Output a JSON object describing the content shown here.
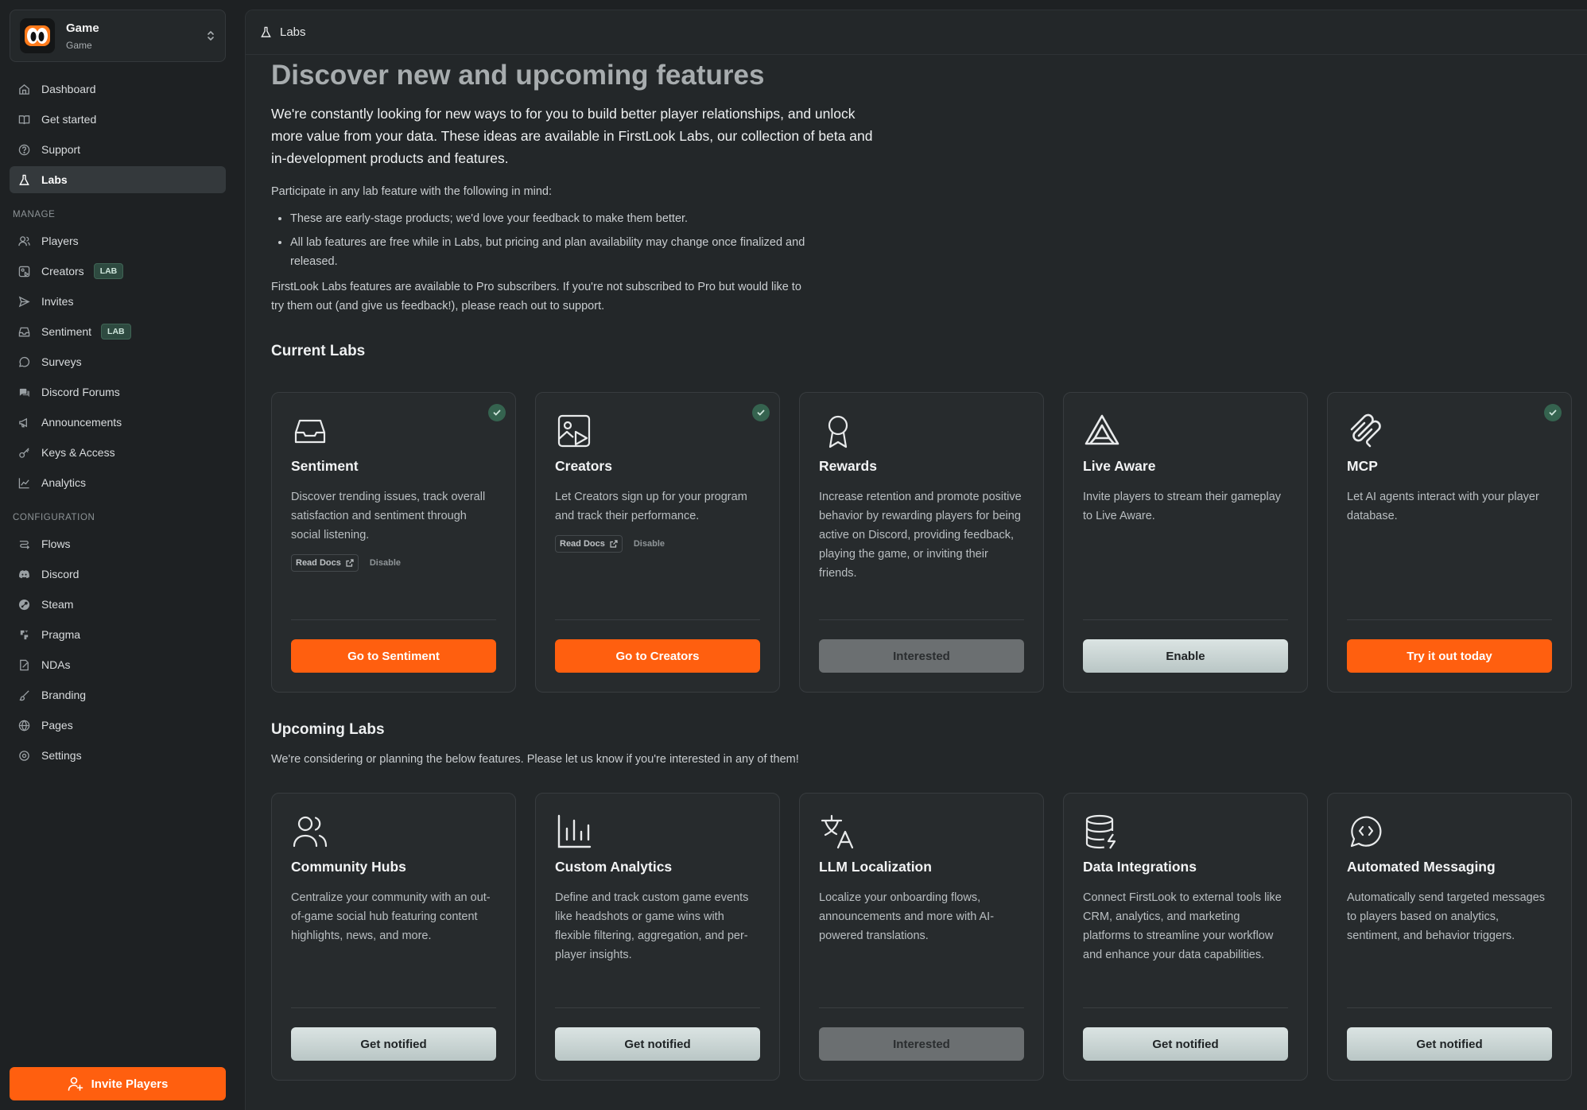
{
  "workspace": {
    "title": "Game",
    "subtitle": "Game"
  },
  "nav_top": [
    {
      "label": "Dashboard",
      "icon": "home-icon"
    },
    {
      "label": "Get started",
      "icon": "book-icon"
    },
    {
      "label": "Support",
      "icon": "help-circle-icon"
    },
    {
      "label": "Labs",
      "icon": "flask-icon",
      "active": true
    }
  ],
  "sections": {
    "manage": "MANAGE",
    "configuration": "CONFIGURATION"
  },
  "nav_manage": [
    {
      "label": "Players",
      "icon": "users-icon"
    },
    {
      "label": "Creators",
      "icon": "creators-icon",
      "badge": "LAB"
    },
    {
      "label": "Invites",
      "icon": "send-icon"
    },
    {
      "label": "Sentiment",
      "icon": "inbox-icon",
      "badge": "LAB"
    },
    {
      "label": "Surveys",
      "icon": "chat-icon"
    },
    {
      "label": "Discord Forums",
      "icon": "forum-icon"
    },
    {
      "label": "Announcements",
      "icon": "megaphone-icon"
    },
    {
      "label": "Keys & Access",
      "icon": "key-icon"
    },
    {
      "label": "Analytics",
      "icon": "chart-line-icon"
    }
  ],
  "nav_config": [
    {
      "label": "Flows",
      "icon": "flows-icon"
    },
    {
      "label": "Discord",
      "icon": "discord-icon"
    },
    {
      "label": "Steam",
      "icon": "steam-icon"
    },
    {
      "label": "Pragma",
      "icon": "pragma-icon"
    },
    {
      "label": "NDAs",
      "icon": "document-icon"
    },
    {
      "label": "Branding",
      "icon": "brush-icon"
    },
    {
      "label": "Pages",
      "icon": "globe-icon"
    },
    {
      "label": "Settings",
      "icon": "gear-icon"
    }
  ],
  "invite_button": "Invite Players",
  "breadcrumb": "Labs",
  "page": {
    "title": "Discover new and upcoming features",
    "intro": "We're constantly looking for new ways to for you to build better player relationships, and unlock more value from your data. These ideas are available in FirstLook Labs, our collection of beta and in-development products and features.",
    "participate": "Participate in any lab feature with the following in mind:",
    "bullets": [
      "These are early-stage products; we'd love your feedback to make them better.",
      "All lab features are free while in Labs, but pricing and plan availability may change once finalized and released."
    ],
    "pro_note": "FirstLook Labs features are available to Pro subscribers. If you're not subscribed to Pro but would like to try them out (and give us feedback!), please reach out to support."
  },
  "current": {
    "heading": "Current Labs",
    "read_docs": "Read Docs",
    "disable": "Disable",
    "cards": [
      {
        "title": "Sentiment",
        "desc": "Discover trending issues, track overall satisfaction and sentiment through social listening.",
        "button": "Go to Sentiment"
      },
      {
        "title": "Creators",
        "desc": "Let Creators sign up for your program and track their performance.",
        "button": "Go to Creators"
      },
      {
        "title": "Rewards",
        "desc": "Increase retention and promote positive behavior by rewarding players for being active on Discord, providing feedback, playing the game, or inviting their friends.",
        "button": "Interested"
      },
      {
        "title": "Live Aware",
        "desc": "Invite players to stream their gameplay to Live Aware.",
        "button": "Enable"
      },
      {
        "title": "MCP",
        "desc": "Let AI agents interact with your player database.",
        "button": "Try it out today"
      }
    ]
  },
  "upcoming": {
    "heading": "Upcoming Labs",
    "desc": "We're considering or planning the below features. Please let us know if you're interested in any of them!",
    "cards": [
      {
        "title": "Community Hubs",
        "desc": "Centralize your community with an out-of-game social hub featuring content highlights, news, and more.",
        "button": "Get notified"
      },
      {
        "title": "Custom Analytics",
        "desc": "Define and track custom game events like headshots or game wins with flexible filtering, aggregation, and per-player insights.",
        "button": "Get notified"
      },
      {
        "title": "LLM Localization",
        "desc": "Localize your onboarding flows, announcements and more with AI-powered translations.",
        "button": "Interested"
      },
      {
        "title": "Data Integrations",
        "desc": "Connect FirstLook to external tools like CRM, analytics, and marketing platforms to streamline your workflow and enhance your data capabilities.",
        "button": "Get notified"
      },
      {
        "title": "Automated Messaging",
        "desc": "Automatically send targeted messages to players based on analytics, sentiment, and behavior triggers.",
        "button": "Get notified"
      }
    ]
  },
  "colors": {
    "accent": "#ff5f0f",
    "background": "#1e2123",
    "panel": "#232729",
    "lab_badge": "#2e4a40",
    "check": "#35634f"
  }
}
